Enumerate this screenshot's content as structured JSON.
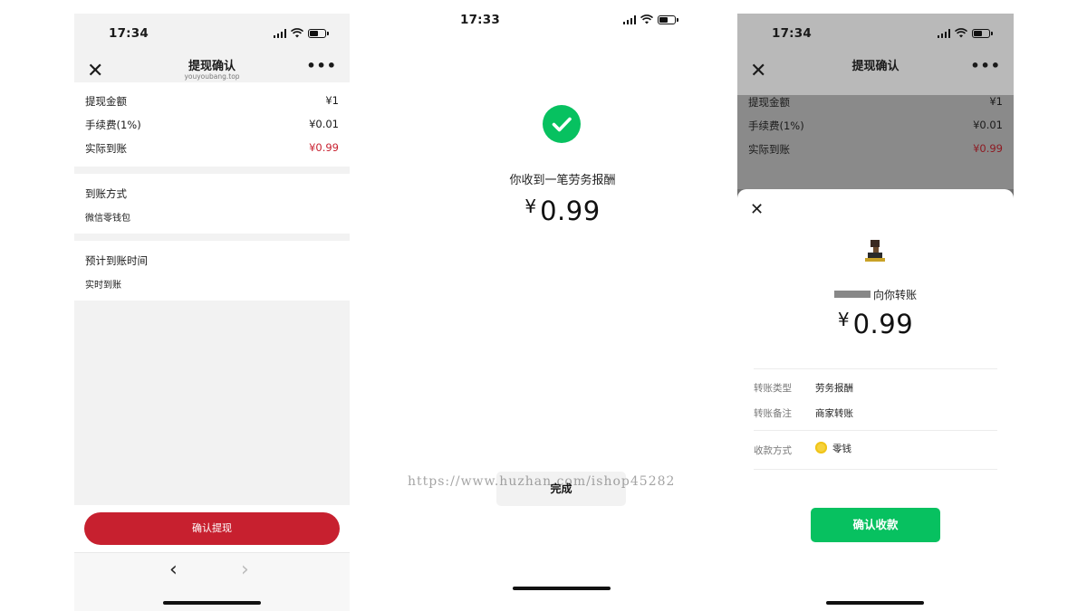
{
  "screen1": {
    "status": {
      "time": "17:34"
    },
    "nav": {
      "title": "提现确认",
      "subtitle": "youyoubang.top"
    },
    "summary": [
      {
        "label": "提现金额",
        "value": "¥1"
      },
      {
        "label": "手续费(1%)",
        "value": "¥0.01"
      },
      {
        "label": "实际到账",
        "value": "¥0.99"
      }
    ],
    "method": {
      "title": "到账方式",
      "value": "微信零钱包"
    },
    "eta": {
      "title": "预计到账时间",
      "value": "实时到账"
    },
    "confirm_label": "确认提现"
  },
  "screen2": {
    "status": {
      "time": "17:33"
    },
    "message": "你收到一笔劳务报酬",
    "currency": "¥",
    "amount": "0.99",
    "done_label": "完成",
    "watermark": "https://www.huzhan.com/ishop45282"
  },
  "screen3": {
    "status": {
      "time": "17:34"
    },
    "nav": {
      "title": "提现确认"
    },
    "summary": [
      {
        "label": "提现金额",
        "value": "¥1"
      },
      {
        "label": "手续费(1%)",
        "value": "¥0.01"
      },
      {
        "label": "实际到账",
        "value": "¥0.99"
      }
    ],
    "from_text": "向你转账",
    "currency": "¥",
    "amount": "0.99",
    "details": [
      {
        "label": "转账类型",
        "value": "劳务报酬"
      },
      {
        "label": "转账备注",
        "value": "商家转账"
      }
    ],
    "receive_method": {
      "label": "收款方式",
      "value": "零钱"
    },
    "receive_label": "确认收款"
  },
  "colors": {
    "wechat_green": "#07c160",
    "brand_red": "#c7202f"
  }
}
